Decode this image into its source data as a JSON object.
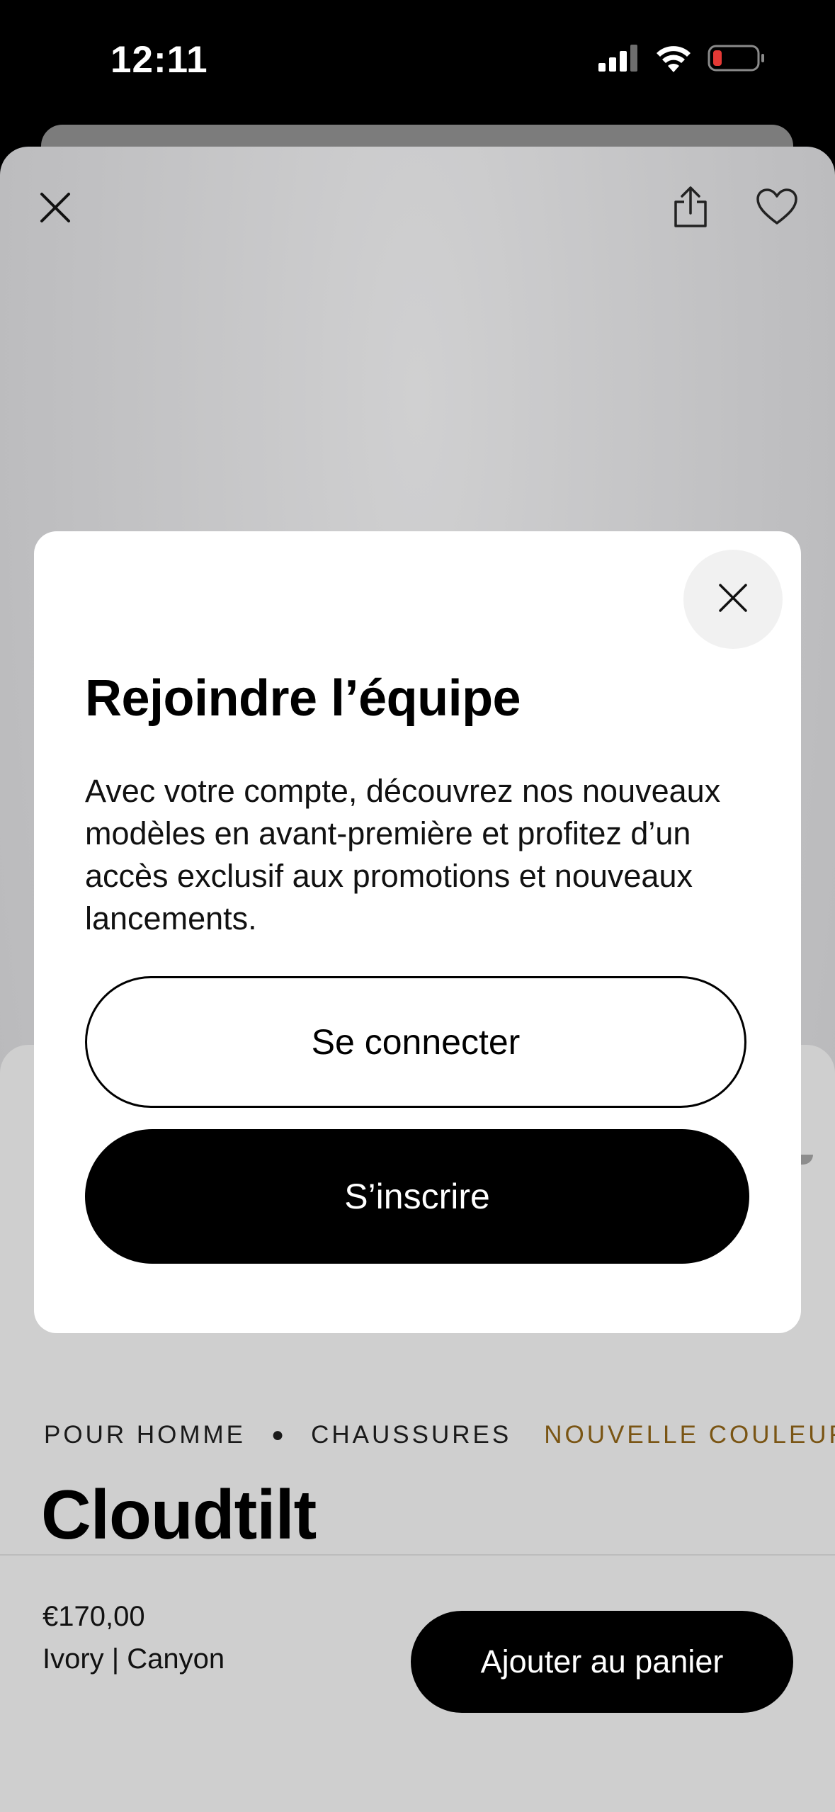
{
  "status_bar": {
    "time": "12:11",
    "icons": [
      "cellular-signal-icon",
      "wifi-icon",
      "battery-low-icon"
    ],
    "battery_color": "#e53935"
  },
  "product_page": {
    "icons": [
      "close-icon",
      "share-icon",
      "heart-icon"
    ],
    "tags": {
      "category_1": "POUR HOMME",
      "category_2": "CHAUSSURES",
      "badge": "NOUVELLE COULEUR",
      "badge_color": "#7a5514"
    },
    "name": "Cloudtilt",
    "price": "€170,00",
    "variant": "Ivory | Canyon",
    "add_to_cart_label": "Ajouter au panier"
  },
  "modal": {
    "title": "Rejoindre l’équipe",
    "body": "Avec votre compte, découvrez nos nouveaux modèles en avant-première et profitez d’un accès exclusif aux promotions et nouveaux lancements.",
    "login_label": "Se connecter",
    "signup_label": "S’inscrire",
    "close_icon": "close-icon"
  }
}
